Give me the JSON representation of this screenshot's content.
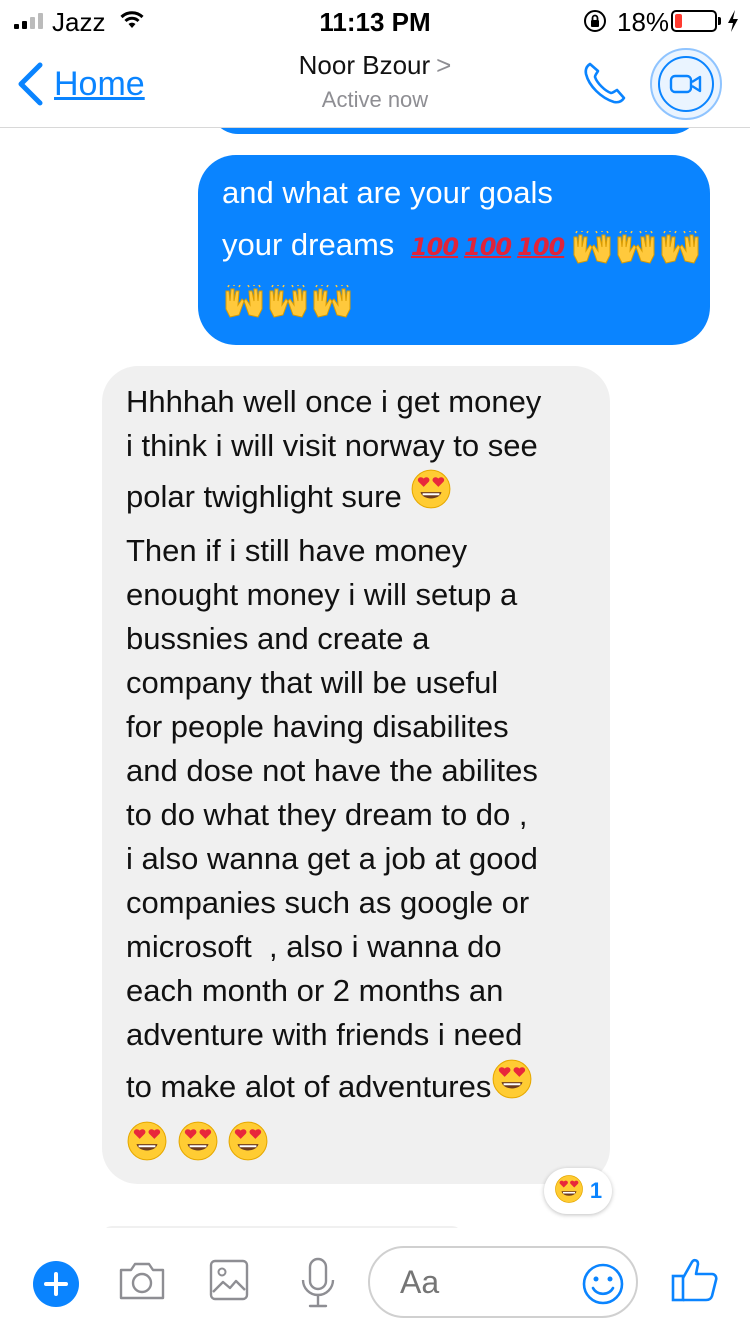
{
  "status_bar": {
    "carrier": "Jazz",
    "time": "11:13 PM",
    "battery_percent": "18%",
    "battery_level": 0.18,
    "battery_color": "#ff3b30",
    "signal_bars_filled": 2,
    "signal_bars_total": 4
  },
  "nav": {
    "back_label": "Home",
    "contact_name": "Noor Bzour",
    "contact_chevron": ">",
    "contact_status": "Active now",
    "accent_color": "#0a84ff"
  },
  "messages": {
    "outgoing": {
      "line1": "and what are your goals",
      "line2_text": "your dreams",
      "hundred_emoji": "100",
      "hundred_count": 3,
      "raised_hands_count": 6
    },
    "incoming": {
      "lines": [
        "Hhhhah well once i get money",
        "i think i will visit norway to see",
        "polar twighlight sure",
        "Then if i still have money",
        "enought money i will setup a",
        "bussnies and create a",
        "company that will be useful",
        "for people having disabilites",
        "and dose not have the abilites",
        "to do what they dream to do ,",
        "i also wanna get a job at good",
        "companies such as google or",
        "microsoft  , also i wanna do",
        "each month or 2 months an",
        "adventure with friends i need",
        "to make alot of adventures"
      ],
      "heart_eyes_after_line3": 1,
      "heart_eyes_after_line16": 1,
      "heart_eyes_final_line": 3
    },
    "reaction": {
      "emoji": "heart-eyes",
      "count": "1"
    }
  },
  "composer": {
    "placeholder": "Aa",
    "icons": [
      "plus-icon",
      "camera-icon",
      "image-icon",
      "microphone-icon",
      "smiley-icon",
      "thumbs-up-icon"
    ]
  }
}
